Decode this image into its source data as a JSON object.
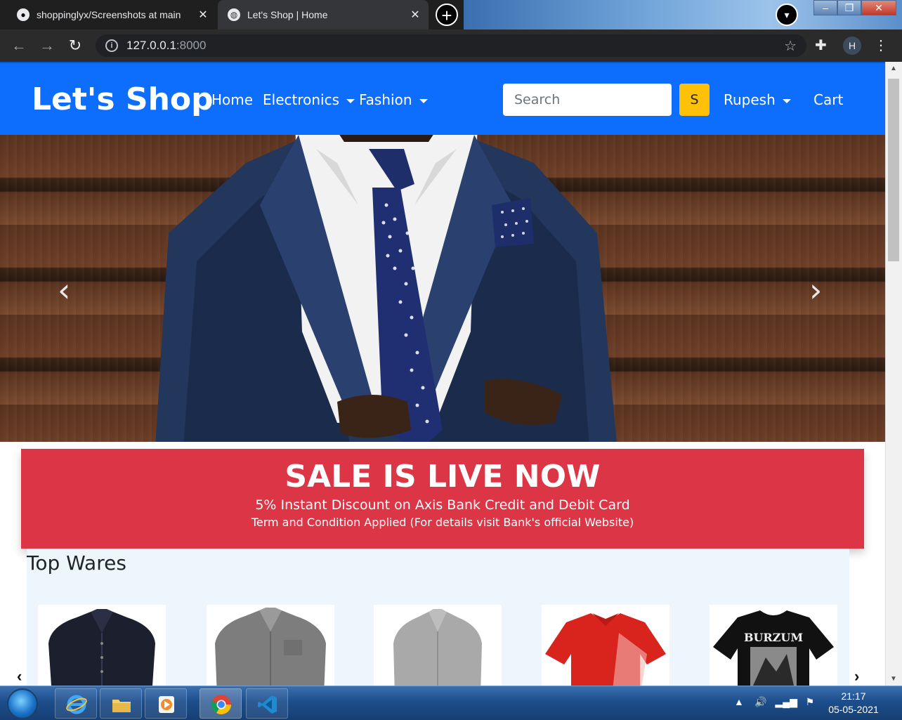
{
  "browser": {
    "tabs": [
      {
        "title": "shoppinglyx/Screenshots at main",
        "active": true
      },
      {
        "title": "Let's Shop | Home",
        "active": false
      }
    ],
    "url_host": "127.0.0.1",
    "url_port": ":8000",
    "profile_initial": "H"
  },
  "site": {
    "brand": "Let's Shop",
    "nav": {
      "home": "Home",
      "electronics": "Electronics",
      "fashion": "Fashion",
      "user": "Rupesh",
      "cart": "Cart"
    },
    "search": {
      "placeholder": "Search",
      "button_label": "S"
    },
    "carousel": {
      "prev": "‹",
      "next": "›"
    },
    "sale": {
      "title": "SALE IS LIVE NOW",
      "subtitle": "5% Instant Discount on Axis Bank Credit and Debit Card",
      "note": "Term and Condition Applied (For details visit Bank's official Website)"
    },
    "top_wares": {
      "heading": "Top Wares",
      "products": [
        {
          "name": "navy-shirt",
          "color": "#1c1f2e"
        },
        {
          "name": "grey-shirt",
          "color": "#7d7d7d"
        },
        {
          "name": "light-grey-shirt",
          "color": "#a9a9a9"
        },
        {
          "name": "red-polo",
          "color": "#d9231d"
        },
        {
          "name": "black-band-tshirt",
          "color": "#111111",
          "print": "BURZUM"
        }
      ]
    }
  },
  "taskbar": {
    "time": "21:17",
    "date": "05-05-2021"
  },
  "colors": {
    "navbar": "#0d6efd",
    "search_button": "#ffc107",
    "sale_banner": "#dc3545",
    "top_wares_bg": "#eef6fd"
  }
}
